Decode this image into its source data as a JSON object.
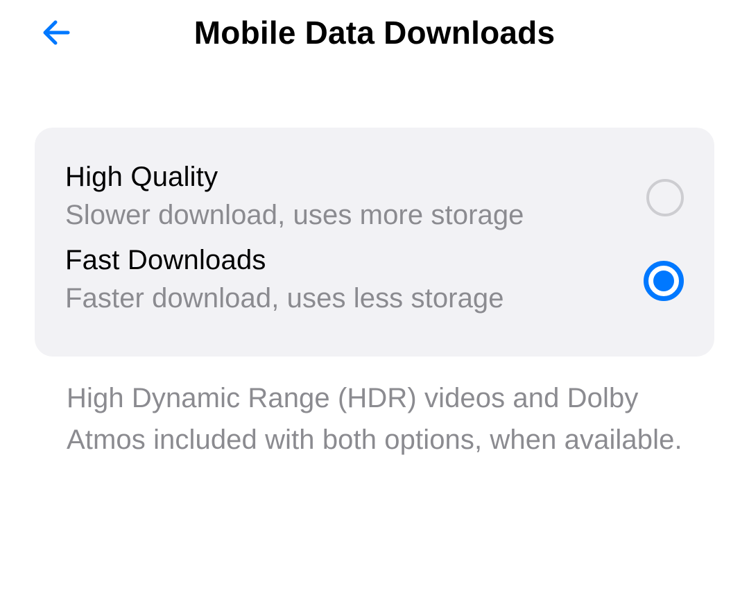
{
  "header": {
    "title": "Mobile Data Downloads"
  },
  "options": [
    {
      "title": "High Quality",
      "subtitle": "Slower download, uses more storage",
      "selected": false
    },
    {
      "title": "Fast Downloads",
      "subtitle": "Faster download, uses less storage",
      "selected": true
    }
  ],
  "footer_note": "High Dynamic Range (HDR) videos and Dolby Atmos included with both options, when available."
}
